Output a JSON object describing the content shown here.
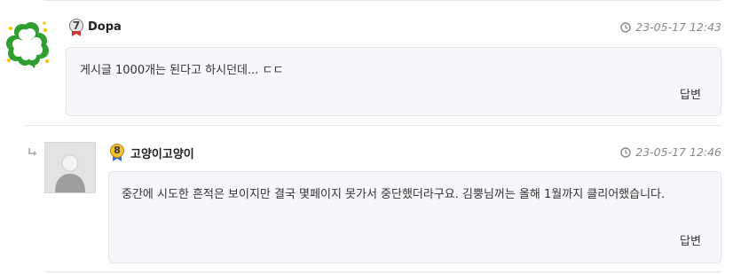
{
  "comments": [
    {
      "level": "7",
      "username": "Dopa",
      "timestamp": "23-05-17 12:43",
      "text": "게시글 1000개는 된다고 하시던데... ㄷㄷ",
      "reply_label": "답변",
      "avatar_icon": "clover-icon"
    },
    {
      "level": "8",
      "username": "고양이고양이",
      "timestamp": "23-05-17 12:46",
      "text": "중간에 시도한 흔적은 보이지만 결국 몇페이지 못가서 중단했더라구요. 김뿡님꺼는 올해 1월까지 클리어했습니다.",
      "reply_label": "답변",
      "avatar_icon": "default-user-icon",
      "is_reply": true
    }
  ],
  "colors": {
    "bubble_bg": "#f6f7fa",
    "bubble_border": "#e4e6ea",
    "time_text": "#8a8a8a",
    "level7_badge": "#6b6b6b",
    "level8_badge": "#d4a017"
  }
}
